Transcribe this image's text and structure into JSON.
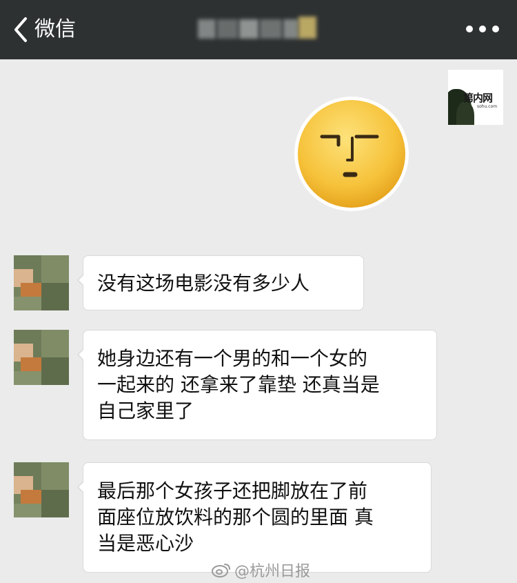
{
  "nav": {
    "back_label": "微信",
    "contact_name": "",
    "more_icon": "more-dots-icon",
    "colors": {
      "bar": "#2e3132",
      "text": "#ffffff"
    }
  },
  "self": {
    "avatar_logo_text": "第内网",
    "avatar_logo_sub": "sohu.com",
    "sticker": "smirk-face-emoji"
  },
  "messages": [
    {
      "sender": "other",
      "lines": [
        "没有这场电影没有多少人"
      ]
    },
    {
      "sender": "other",
      "lines": [
        "她身边还有一个男的和一个女的",
        "一起来的 还拿来了靠垫 还真当是",
        "自己家里了"
      ]
    },
    {
      "sender": "other",
      "lines": [
        "最后那个女孩子还把脚放在了前",
        "面座位放饮料的那个圆的里面 真",
        "当是恶心沙"
      ]
    }
  ],
  "watermark": {
    "icon": "weibo-icon",
    "text": "@杭州日报"
  }
}
